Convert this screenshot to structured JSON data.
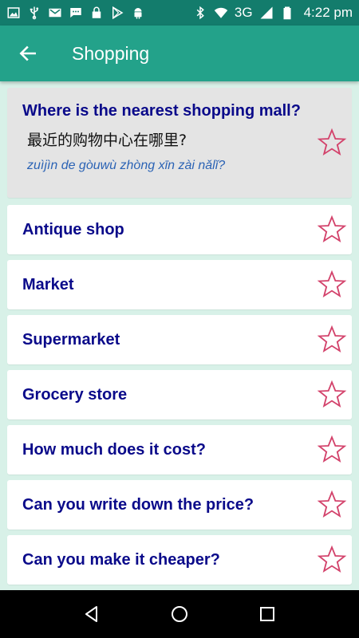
{
  "status_bar": {
    "left_icons": [
      "image-icon",
      "usb-icon",
      "gmail-icon",
      "message-icon",
      "lock-icon",
      "play-store-icon",
      "android-icon"
    ],
    "right_icons": [
      "bluetooth-icon",
      "wifi-icon"
    ],
    "network": "3G",
    "time": "4:22 pm",
    "background": "#137c6c"
  },
  "app_bar": {
    "title": "Shopping",
    "background": "#23a28a"
  },
  "featured": {
    "phrase": "Where is the nearest shopping mall?",
    "chinese": "最近的购物中心在哪里?",
    "pinyin": "zuìjìn de gòuwù zhòng xīn zài nǎlǐ?"
  },
  "items": [
    {
      "phrase": "Antique shop"
    },
    {
      "phrase": "Market"
    },
    {
      "phrase": "Supermarket"
    },
    {
      "phrase": "Grocery store"
    },
    {
      "phrase": "How much does it cost?"
    },
    {
      "phrase": "Can you write down the price?"
    },
    {
      "phrase": "Can you make it cheaper?"
    }
  ],
  "colors": {
    "phrase_text": "#0a0a8a",
    "pinyin_text": "#2b63b5",
    "star_outline": "#d3426b",
    "list_background": "#d8f1e8"
  },
  "nav_bar": {
    "buttons": [
      "back-triangle-icon",
      "home-circle-icon",
      "recents-square-icon"
    ]
  }
}
